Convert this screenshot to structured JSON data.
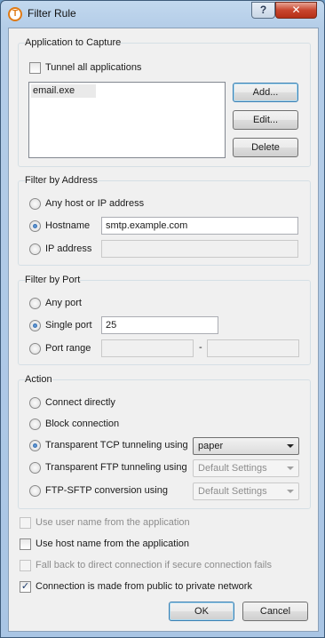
{
  "window": {
    "title": "Filter Rule",
    "help_symbol": "?",
    "close_symbol": "✕",
    "app_icon_letter": "T"
  },
  "app_capture": {
    "title": "Application to Capture",
    "tunnel_all_label": "Tunnel all applications",
    "tunnel_all_checked": false,
    "applications": [
      "email.exe"
    ],
    "add_label": "Add...",
    "edit_label": "Edit...",
    "delete_label": "Delete"
  },
  "filter_address": {
    "title": "Filter by Address",
    "any_label": "Any host or IP address",
    "hostname_label": "Hostname",
    "hostname_value": "smtp.example.com",
    "ip_label": "IP address",
    "ip_value": "",
    "selected": "hostname"
  },
  "filter_port": {
    "title": "Filter by Port",
    "any_label": "Any port",
    "single_label": "Single port",
    "single_value": "25",
    "range_label": "Port range",
    "range_from": "",
    "range_separator": "-",
    "range_to": "",
    "selected": "single"
  },
  "action": {
    "title": "Action",
    "connect_label": "Connect directly",
    "block_label": "Block connection",
    "tcp_label": "Transparent TCP tunneling using",
    "tcp_value": "paper",
    "ftp_label": "Transparent FTP tunneling using",
    "ftp_value": "Default Settings",
    "sftp_label": "FTP-SFTP conversion using",
    "sftp_value": "Default Settings",
    "selected": "tcp"
  },
  "options": {
    "use_user_name": {
      "label": "Use user name from the application",
      "checked": false,
      "enabled": false
    },
    "use_host_name": {
      "label": "Use host name from the application",
      "checked": false,
      "enabled": true
    },
    "fall_back": {
      "label": "Fall back to direct connection if secure connection fails",
      "checked": false,
      "enabled": false
    },
    "public_private": {
      "label": "Connection is made from public to private network",
      "checked": true,
      "enabled": true
    }
  },
  "buttons": {
    "ok": "OK",
    "cancel": "Cancel"
  },
  "colors": {
    "accent": "#1d4f91",
    "close_button": "#c8452e",
    "frame": "#a9c5e4"
  }
}
